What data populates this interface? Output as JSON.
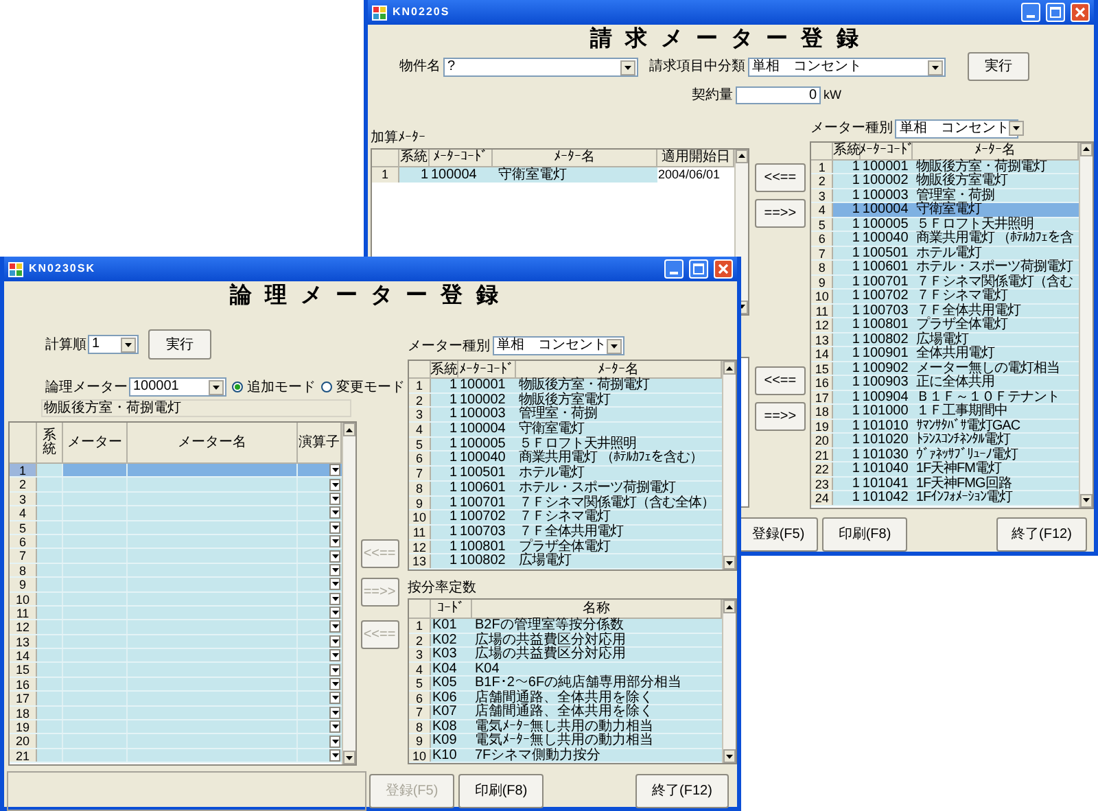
{
  "back_window": {
    "title": "KN0220S",
    "heading": "請求メーター登録",
    "fields": [
      {
        "label": "物件名",
        "value": "?"
      },
      {
        "label": "請求項目中分類",
        "value": "単相　コンセント"
      }
    ],
    "run_button": "実行",
    "contract": {
      "label": "契約量",
      "value": "0",
      "unit": "kW"
    },
    "added_meters": {
      "label": "加算ﾒｰﾀｰ",
      "columns": [
        "系統",
        "ﾒｰﾀｰｺｰﾄﾞ",
        "ﾒｰﾀｰ名",
        "適用開始日"
      ],
      "rows": [
        {
          "number": "1",
          "system": "1",
          "code": "100004",
          "name": "守衛室電灯",
          "start_date": "2004/06/01"
        }
      ]
    },
    "transfer_buttons": [
      "<<==",
      "==>>",
      "<<==",
      "==>>"
    ],
    "meter_type": {
      "label": "メーター種別",
      "value": "単相　コンセント"
    },
    "meter_list": {
      "columns": [
        "系統",
        "ﾒｰﾀｰｺｰﾄﾞ",
        "ﾒｰﾀｰ名"
      ],
      "rows": [
        {
          "number": "1",
          "system": "1",
          "code": "100001",
          "name": "物販後方室・荷捌電灯",
          "selected": false
        },
        {
          "number": "2",
          "system": "1",
          "code": "100002",
          "name": "物販後方室電灯",
          "selected": false
        },
        {
          "number": "3",
          "system": "1",
          "code": "100003",
          "name": "管理室・荷捌",
          "selected": false
        },
        {
          "number": "4",
          "system": "1",
          "code": "100004",
          "name": "守衛室電灯",
          "selected": true
        },
        {
          "number": "5",
          "system": "1",
          "code": "100005",
          "name": "５Ｆロフト天井照明",
          "selected": false
        },
        {
          "number": "6",
          "system": "1",
          "code": "100040",
          "name": "商業共用電灯 （ﾎﾃﾙｶﾌｪを含",
          "selected": false
        },
        {
          "number": "7",
          "system": "1",
          "code": "100501",
          "name": "ホテル電灯",
          "selected": false
        },
        {
          "number": "8",
          "system": "1",
          "code": "100601",
          "name": "ホテル・スポーツ荷捌電灯",
          "selected": false
        },
        {
          "number": "9",
          "system": "1",
          "code": "100701",
          "name": "７Ｆシネマ関係電灯（含む",
          "selected": false
        },
        {
          "number": "10",
          "system": "1",
          "code": "100702",
          "name": "７Ｆシネマ電灯",
          "selected": false
        },
        {
          "number": "11",
          "system": "1",
          "code": "100703",
          "name": "７Ｆ全体共用電灯",
          "selected": false
        },
        {
          "number": "12",
          "system": "1",
          "code": "100801",
          "name": "プラザ全体電灯",
          "selected": false
        },
        {
          "number": "13",
          "system": "1",
          "code": "100802",
          "name": "広場電灯",
          "selected": false
        },
        {
          "number": "14",
          "system": "1",
          "code": "100901",
          "name": "全体共用電灯",
          "selected": false
        },
        {
          "number": "15",
          "system": "1",
          "code": "100902",
          "name": "メーター無しの電灯相当",
          "selected": false
        },
        {
          "number": "16",
          "system": "1",
          "code": "100903",
          "name": "正に全体共用",
          "selected": false
        },
        {
          "number": "17",
          "system": "1",
          "code": "100904",
          "name": "Ｂ１Ｆ～１０Ｆテナント",
          "selected": false
        },
        {
          "number": "18",
          "system": "1",
          "code": "101000",
          "name": "１Ｆ工事期間中",
          "selected": false
        },
        {
          "number": "19",
          "system": "1",
          "code": "101010",
          "name": "ｻﾏﾝｻﾀﾊﾞｻ電灯GAC",
          "selected": false
        },
        {
          "number": "20",
          "system": "1",
          "code": "101020",
          "name": "ﾄﾗﾝｽｺﾝﾁﾈﾝﾀﾙ電灯",
          "selected": false
        },
        {
          "number": "21",
          "system": "1",
          "code": "101030",
          "name": "ｳﾞｧﾈｯｻﾌﾞﾘｭｰﾉ電灯",
          "selected": false
        },
        {
          "number": "22",
          "system": "1",
          "code": "101040",
          "name": "1F天神FM電灯",
          "selected": false
        },
        {
          "number": "23",
          "system": "1",
          "code": "101041",
          "name": "1F天神FMG回路",
          "selected": false
        },
        {
          "number": "24",
          "system": "1",
          "code": "101042",
          "name": "1Fｲﾝﾌｫﾒｰｼｮﾝ電灯",
          "selected": false
        }
      ]
    },
    "footer_buttons": [
      "登録(F5)",
      "印刷(F8)",
      "終了(F12)"
    ]
  },
  "front_window": {
    "title": "KN0230SK",
    "heading": "論理メーター登録",
    "order": {
      "label": "計算順",
      "value": "1"
    },
    "run_button": "実行",
    "logical_meter": {
      "label": "論理メーター",
      "value": "100001"
    },
    "modes": [
      {
        "label": "追加モード",
        "selected": true
      },
      {
        "label": "変更モード",
        "selected": false
      }
    ],
    "meter_name": "物販後方室・荷捌電灯",
    "formula": {
      "columns": [
        "系統",
        "メーター",
        "メーター名",
        "演算子"
      ],
      "rows": [
        {
          "number": "1",
          "selected": true
        },
        {
          "number": "2",
          "selected": false
        },
        {
          "number": "3",
          "selected": false
        },
        {
          "number": "4",
          "selected": false
        },
        {
          "number": "5",
          "selected": false
        },
        {
          "number": "6",
          "selected": false
        },
        {
          "number": "7",
          "selected": false
        },
        {
          "number": "8",
          "selected": false
        },
        {
          "number": "9",
          "selected": false
        },
        {
          "number": "10",
          "selected": false
        },
        {
          "number": "11",
          "selected": false
        },
        {
          "number": "12",
          "selected": false
        },
        {
          "number": "13",
          "selected": false
        },
        {
          "number": "14",
          "selected": false
        },
        {
          "number": "15",
          "selected": false
        },
        {
          "number": "16",
          "selected": false
        },
        {
          "number": "17",
          "selected": false
        },
        {
          "number": "18",
          "selected": false
        },
        {
          "number": "19",
          "selected": false
        },
        {
          "number": "20",
          "selected": false
        },
        {
          "number": "21",
          "selected": false
        }
      ]
    },
    "transfer_buttons": [
      {
        "label": "<<==",
        "disabled": true
      },
      {
        "label": "==>>",
        "disabled": true
      },
      {
        "label": "<<==",
        "disabled": true
      }
    ],
    "meter_type": {
      "label": "メーター種別",
      "value": "単相　コンセント"
    },
    "meter_list": {
      "columns": [
        "系統",
        "ﾒｰﾀｰｺｰﾄﾞ",
        "ﾒｰﾀｰ名"
      ],
      "rows": [
        {
          "number": "1",
          "system": "1",
          "code": "100001",
          "name": "物販後方室・荷捌電灯"
        },
        {
          "number": "2",
          "system": "1",
          "code": "100002",
          "name": "物販後方室電灯"
        },
        {
          "number": "3",
          "system": "1",
          "code": "100003",
          "name": "管理室・荷捌"
        },
        {
          "number": "4",
          "system": "1",
          "code": "100004",
          "name": "守衛室電灯"
        },
        {
          "number": "5",
          "system": "1",
          "code": "100005",
          "name": "５Ｆロフト天井照明"
        },
        {
          "number": "6",
          "system": "1",
          "code": "100040",
          "name": "商業共用電灯 （ﾎﾃﾙｶﾌｪを含む）"
        },
        {
          "number": "7",
          "system": "1",
          "code": "100501",
          "name": "ホテル電灯"
        },
        {
          "number": "8",
          "system": "1",
          "code": "100601",
          "name": "ホテル・スポーツ荷捌電灯"
        },
        {
          "number": "9",
          "system": "1",
          "code": "100701",
          "name": "７Ｆシネマ関係電灯（含む全体）"
        },
        {
          "number": "10",
          "system": "1",
          "code": "100702",
          "name": "７Ｆシネマ電灯"
        },
        {
          "number": "11",
          "system": "1",
          "code": "100703",
          "name": "７Ｆ全体共用電灯"
        },
        {
          "number": "12",
          "system": "1",
          "code": "100801",
          "name": "プラザ全体電灯"
        },
        {
          "number": "13",
          "system": "1",
          "code": "100802",
          "name": "広場電灯"
        }
      ]
    },
    "ratios": {
      "label": "按分率定数",
      "columns": [
        "ｺｰﾄﾞ",
        "名称"
      ],
      "rows": [
        {
          "number": "1",
          "code": "K01",
          "name": "B2Fの管理室等按分係数"
        },
        {
          "number": "2",
          "code": "K02",
          "name": "広場の共益費区分対応用"
        },
        {
          "number": "3",
          "code": "K03",
          "name": "広場の共益費区分対応用"
        },
        {
          "number": "4",
          "code": "K04",
          "name": "K04"
        },
        {
          "number": "5",
          "code": "K05",
          "name": "B1F･2～6Fの純店舗専用部分相当"
        },
        {
          "number": "6",
          "code": "K06",
          "name": "店舗間通路、全体共用を除く"
        },
        {
          "number": "7",
          "code": "K07",
          "name": "店舗間通路、全体共用を除く"
        },
        {
          "number": "8",
          "code": "K08",
          "name": "電気ﾒｰﾀｰ無し共用の動力相当"
        },
        {
          "number": "9",
          "code": "K09",
          "name": "電気ﾒｰﾀｰ無し共用の動力相当"
        },
        {
          "number": "10",
          "code": "K10",
          "name": "7Fシネマ側動力按分"
        }
      ]
    },
    "footer_buttons": [
      {
        "label": "登録(F5)",
        "disabled": true
      },
      {
        "label": "印刷(F8)",
        "disabled": false
      },
      {
        "label": "終了(F12)",
        "disabled": false
      }
    ]
  }
}
